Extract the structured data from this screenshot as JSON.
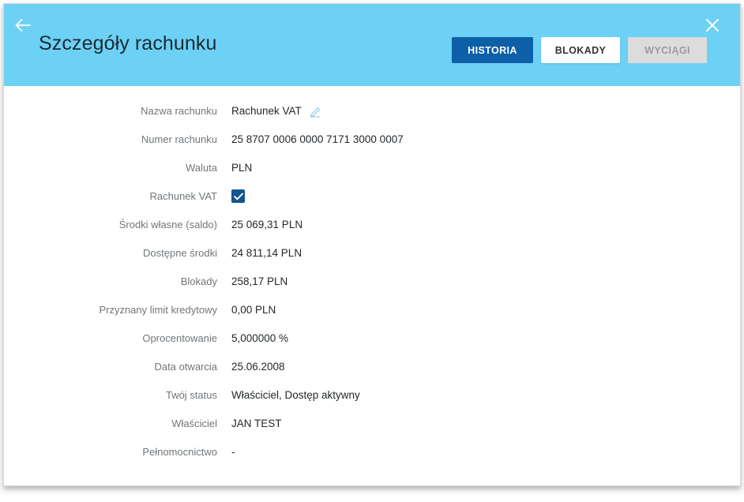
{
  "window": {
    "title": "Szczegóły rachunku"
  },
  "header": {
    "title": "Szczegóły rachunku",
    "back_label": "Wstecz",
    "close_label": "Zamknij",
    "accent_color": "#6dd0f5",
    "primary_button_color": "#0d5fa8",
    "buttons": [
      {
        "label": "HISTORIA",
        "state": "active"
      },
      {
        "label": "BLOKADY",
        "state": "normal"
      },
      {
        "label": "WYCIĄGI",
        "state": "disabled"
      }
    ]
  },
  "details": {
    "rows": [
      {
        "label": "Nazwa rachunku",
        "value": "Rachunek VAT",
        "editable": true
      },
      {
        "label": "Numer rachunku",
        "value": "25 8707 0006 0000 7171 3000 0007"
      },
      {
        "label": "Waluta",
        "value": "PLN"
      },
      {
        "label": "Rachunek VAT",
        "value": "",
        "checkbox": true,
        "checked": true
      },
      {
        "label": "Środki własne (saldo)",
        "value": "25 069,31  PLN"
      },
      {
        "label": "Dostępne środki",
        "value": "24 811,14  PLN"
      },
      {
        "label": "Blokady",
        "value": "258,17  PLN"
      },
      {
        "label": "Przyznany limit kredytowy",
        "value": "0,00  PLN"
      },
      {
        "label": "Oprocentowanie",
        "value": "5,000000 %"
      },
      {
        "label": "Data otwarcia",
        "value": "25.06.2008"
      },
      {
        "label": "Twój status",
        "value": "Właściciel,  Dostęp aktywny"
      },
      {
        "label": "Właściciel",
        "value": "JAN TEST"
      },
      {
        "label": "Pełnomocnictwo",
        "value": "-"
      }
    ]
  },
  "icons": {
    "back": "arrow-left-icon",
    "close": "close-icon",
    "edit": "pencil-edit-icon",
    "check": "checkmark-icon"
  }
}
